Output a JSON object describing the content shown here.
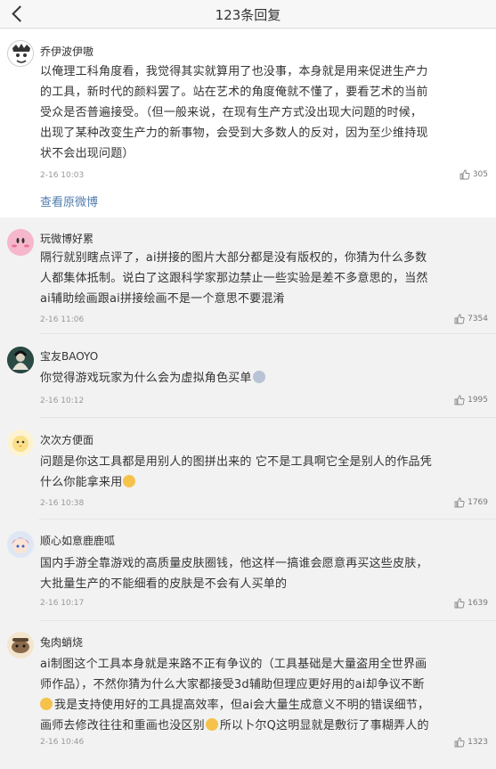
{
  "header": {
    "title": "123条回复"
  },
  "main_post": {
    "username": "乔伊波伊嗷",
    "content_lines": [
      "以俺理工科角度看，我觉得其实就算用了也没事，本身就是用来促进生产力",
      "的工具，新时代的颜料罢了。站在艺术的角度俺就不懂了，要看艺术的当前",
      "受众是否普遍接受。（但一般来说，在现有生产方式没出现大问题的时候，",
      "出现了某种改变生产力的新事物，会受到大多数人的反对，因为至少维持现",
      "状不会出现问题）"
    ],
    "time": "2-16 10:03",
    "likes": "305",
    "view_original": "查看原微博"
  },
  "comments": [
    {
      "username": "玩微博好累",
      "content_lines": [
        "隔行就别瞎点评了，ai拼接的图片大部分都是没有版权的，你猜为什么多数",
        "人都集体抵制。说白了这跟科学家那边禁止一些实验是差不多意思的，当然",
        "ai辅助绘画跟ai拼接绘画不是一个意思不要混淆"
      ],
      "time": "2-16 11:06",
      "likes": "7354"
    },
    {
      "username": "宝友BAOYO",
      "content_lines": [
        "你觉得游戏玩家为什么会为虚拟角色买单"
      ],
      "time": "2-16 10:12",
      "likes": "1995"
    },
    {
      "username": "次次方便面",
      "content_lines": [
        "问题是你这工具都是用别人的图拼出来的 它不是工具啊它全是别人的作品凭",
        "什么你能拿来用"
      ],
      "time": "2-16 10:38",
      "likes": "1769"
    },
    {
      "username": "顺心如意鹿鹿呱",
      "content_lines": [
        "国内手游全靠游戏的高质量皮肤圈钱，他这样一搞谁会愿意再买这些皮肤，",
        "大批量生产的不能细看的皮肤是不会有人买单的"
      ],
      "time": "2-16 10:17",
      "likes": "1639"
    },
    {
      "username": "兔肉蛸烧",
      "content_lines": [
        "ai制图这个工具本身就是来路不正有争议的（工具基础是大量盗用全世界画",
        "师作品），不然你猜为什么大家都接受3d辅助但理应更好用的ai却争议不断",
        "我是支持使用好的工具提高效率，但ai会大量生成意义不明的错误细节，",
        "画师去修改往往和重画也没区别",
        "所以卜尔Q这明显就是敷衍了事糊弄人的"
      ],
      "time": "2-16 10:46",
      "likes": "1323"
    }
  ],
  "colors": {
    "link": "#507daf",
    "meta": "#999999",
    "bg": "#f2f2f2"
  },
  "icons": {
    "back": "chevron-left-icon",
    "like": "thumbs-up-icon"
  }
}
